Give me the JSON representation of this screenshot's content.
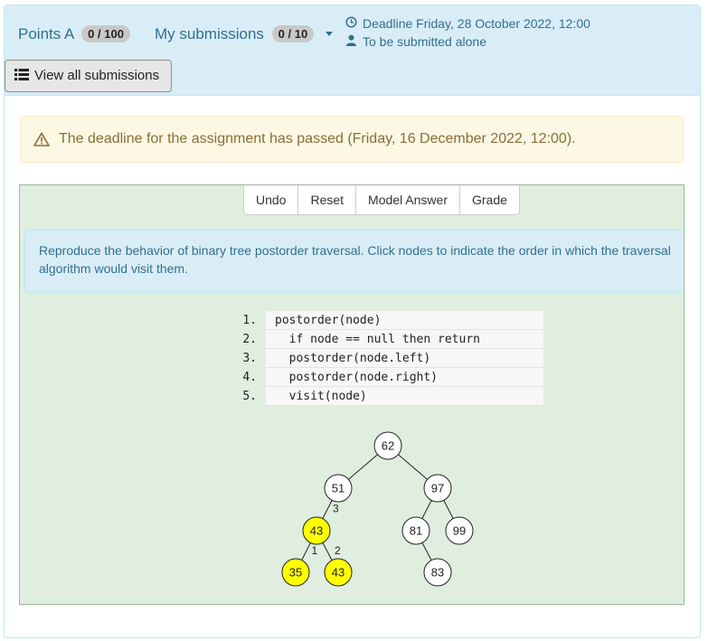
{
  "header": {
    "points_label": "Points A",
    "points_badge": "0 / 100",
    "submissions_label": "My submissions",
    "submissions_badge": "0 / 10",
    "deadline_text": "Deadline Friday, 28 October 2022, 12:00",
    "submit_mode_text": "To be submitted alone",
    "view_all_label": "View all submissions"
  },
  "alert": {
    "text": "The deadline for the assignment has passed (Friday, 16 December 2022, 12:00)."
  },
  "exercise": {
    "buttons": [
      "Undo",
      "Reset",
      "Model Answer",
      "Grade"
    ],
    "instructions": "Reproduce the behavior of binary tree postorder traversal. Click nodes to indicate the order in which the traversal algorithm would visit them.",
    "code": [
      {
        "num": "1.",
        "text": "postorder(node)"
      },
      {
        "num": "2.",
        "text": "  if node == null then return"
      },
      {
        "num": "3.",
        "text": "  postorder(node.left)"
      },
      {
        "num": "4.",
        "text": "  postorder(node.right)"
      },
      {
        "num": "5.",
        "text": "  visit(node)"
      }
    ],
    "tree": {
      "nodes": [
        {
          "id": "n62",
          "value": "62",
          "visited": false
        },
        {
          "id": "n51",
          "value": "51",
          "visited": false
        },
        {
          "id": "n97",
          "value": "97",
          "visited": false
        },
        {
          "id": "n43a",
          "value": "43",
          "visited": true,
          "order": "3"
        },
        {
          "id": "n81",
          "value": "81",
          "visited": false
        },
        {
          "id": "n99",
          "value": "99",
          "visited": false
        },
        {
          "id": "n35",
          "value": "35",
          "visited": true,
          "order": "1"
        },
        {
          "id": "n43b",
          "value": "43",
          "visited": true,
          "order": "2"
        },
        {
          "id": "n83",
          "value": "83",
          "visited": false
        }
      ],
      "edges": [
        [
          "n62",
          "n51"
        ],
        [
          "n62",
          "n97"
        ],
        [
          "n51",
          "n43a"
        ],
        [
          "n97",
          "n81"
        ],
        [
          "n97",
          "n99"
        ],
        [
          "n43a",
          "n35"
        ],
        [
          "n43a",
          "n43b"
        ],
        [
          "n81",
          "n83"
        ]
      ],
      "visited_color": "#ffff00",
      "node_color": "#ffffff"
    }
  }
}
